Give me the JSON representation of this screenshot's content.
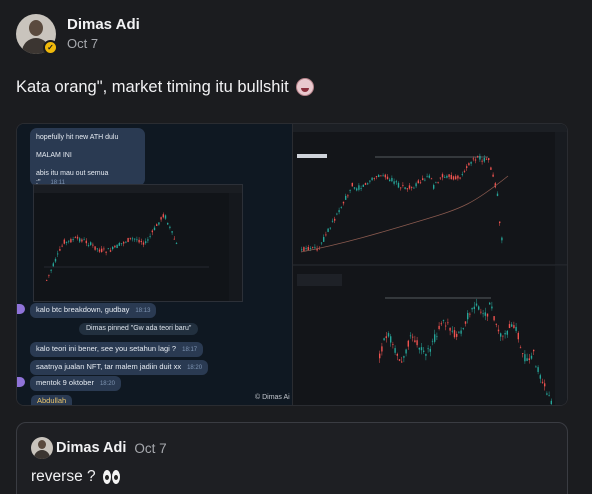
{
  "post": {
    "author": "Dimas Adi",
    "date": "Oct 7",
    "text": "Kata orang\", market timing itu bullshit",
    "emoji_icon": "face-emoji-icon"
  },
  "screenshot": {
    "chat": {
      "big_bubble": [
        "hopefully hit new ATH dulu",
        "MALAM INI",
        "abis itu mau out semua :\""
      ],
      "big_bubble_time": "18:11",
      "breakdown": "kalo btc breakdown, gudbay",
      "breakdown_time": "18:13",
      "pinned": "Dimas pinned \"Gw ada teori baru\"",
      "msg1": "kalo teori ini bener, see you setahun lagi ?",
      "msg1_time": "18:17",
      "msg2": "saatnya jualan NFT, tar malem jadiin duit xx",
      "msg2_time": "18:20",
      "msg3": "mentok 9 oktober",
      "msg3_time": "18:20",
      "abdullah": "Abdullah",
      "watermark": "© Dimas Ai"
    }
  },
  "quote": {
    "author": "Dimas Adi",
    "date": "Oct 7",
    "text": "reverse ?",
    "emoji_icon": "eyes-emoji-icon"
  },
  "colors": {
    "background": "#1b1c1f",
    "chat_bg": "#0f1822",
    "bubble": "#2a3a52",
    "verified": "#f0b90b",
    "bull": "#26a69a",
    "bear": "#ef5350"
  }
}
